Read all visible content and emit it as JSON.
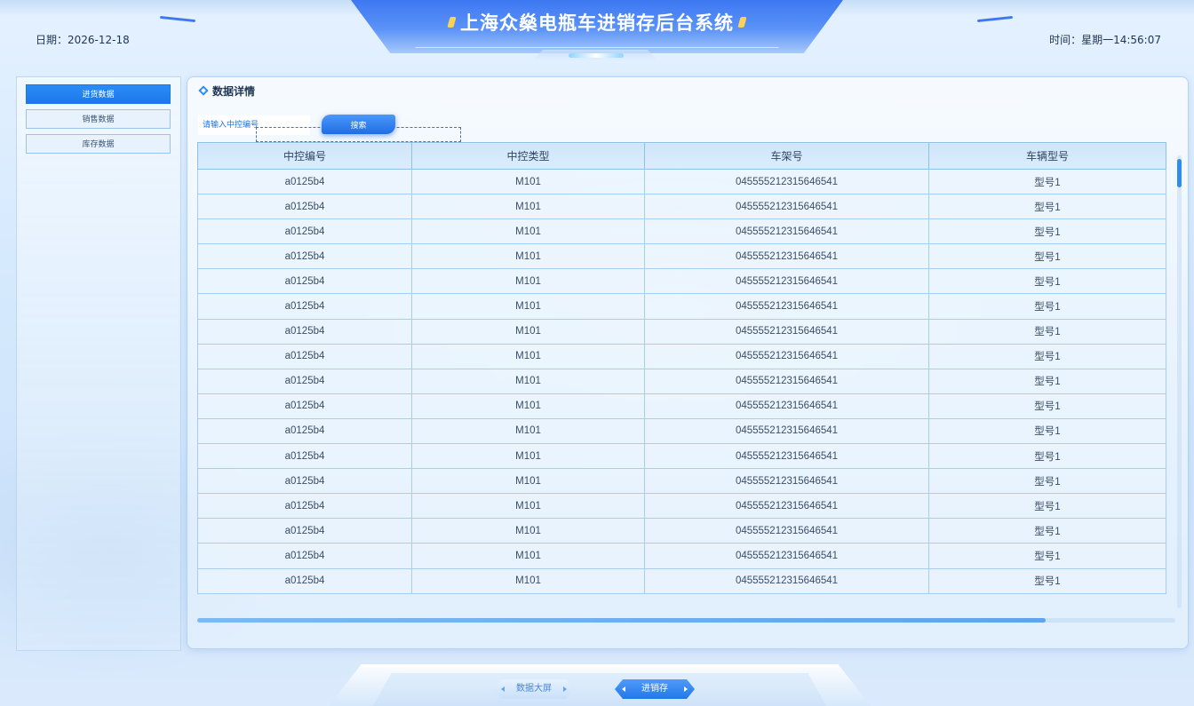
{
  "header": {
    "title": "上海众燊电瓶车进销存后台系统",
    "date_label": "日期：2026-12-18",
    "time_label": "时间：星期一14:56:07"
  },
  "sidebar": {
    "items": [
      {
        "label": "进货数据",
        "active": true
      },
      {
        "label": "销售数据",
        "active": false
      },
      {
        "label": "库存数据",
        "active": false
      }
    ]
  },
  "panel": {
    "title": "数据详情",
    "search": {
      "placeholder": "请输入中控编号",
      "button_label": "搜索"
    },
    "table": {
      "columns": [
        "中控编号",
        "中控类型",
        "车架号",
        "车辆型号"
      ],
      "rows": [
        [
          "a0125b4",
          "M101",
          "045555212315646541",
          "型号1"
        ],
        [
          "a0125b4",
          "M101",
          "045555212315646541",
          "型号1"
        ],
        [
          "a0125b4",
          "M101",
          "045555212315646541",
          "型号1"
        ],
        [
          "a0125b4",
          "M101",
          "045555212315646541",
          "型号1"
        ],
        [
          "a0125b4",
          "M101",
          "045555212315646541",
          "型号1"
        ],
        [
          "a0125b4",
          "M101",
          "045555212315646541",
          "型号1"
        ],
        [
          "a0125b4",
          "M101",
          "045555212315646541",
          "型号1"
        ],
        [
          "a0125b4",
          "M101",
          "045555212315646541",
          "型号1"
        ],
        [
          "a0125b4",
          "M101",
          "045555212315646541",
          "型号1"
        ],
        [
          "a0125b4",
          "M101",
          "045555212315646541",
          "型号1"
        ],
        [
          "a0125b4",
          "M101",
          "045555212315646541",
          "型号1"
        ],
        [
          "a0125b4",
          "M101",
          "045555212315646541",
          "型号1"
        ],
        [
          "a0125b4",
          "M101",
          "045555212315646541",
          "型号1"
        ],
        [
          "a0125b4",
          "M101",
          "045555212315646541",
          "型号1"
        ],
        [
          "a0125b4",
          "M101",
          "045555212315646541",
          "型号1"
        ],
        [
          "a0125b4",
          "M101",
          "045555212315646541",
          "型号1"
        ],
        [
          "a0125b4",
          "M101",
          "045555212315646541",
          "型号1"
        ]
      ]
    }
  },
  "footer": {
    "tabs": [
      {
        "label": "数据大屏",
        "active": false
      },
      {
        "label": "进销存",
        "active": true
      }
    ]
  },
  "colors": {
    "accent": "#2b8cf6",
    "title_plate": "#3d78f2",
    "title_dot": "#ffd256"
  }
}
